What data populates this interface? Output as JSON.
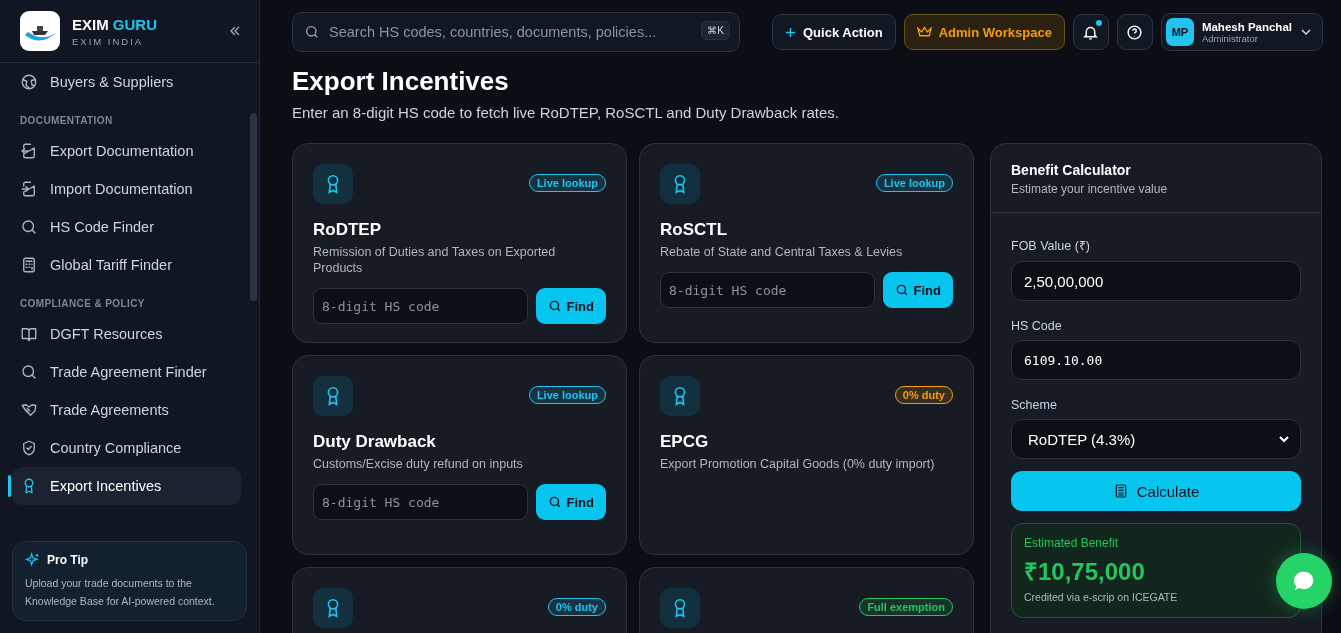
{
  "brand": {
    "name_1": "EXIM",
    "name_2": "GURU",
    "subtitle": "EXIM INDIA"
  },
  "sidebar": {
    "items": [
      {
        "kind": "item",
        "label": "Buyers & Suppliers",
        "selected": false
      },
      {
        "kind": "heading",
        "label": "DOCUMENTATION"
      },
      {
        "kind": "item",
        "label": "Export Documentation",
        "selected": false
      },
      {
        "kind": "item",
        "label": "Import Documentation",
        "selected": false
      },
      {
        "kind": "item",
        "label": "HS Code Finder",
        "selected": false
      },
      {
        "kind": "item",
        "label": "Global Tariff Finder",
        "selected": false
      },
      {
        "kind": "heading",
        "label": "COMPLIANCE & POLICY"
      },
      {
        "kind": "item",
        "label": "DGFT Resources",
        "selected": false
      },
      {
        "kind": "item",
        "label": "Trade Agreement Finder",
        "selected": false
      },
      {
        "kind": "item",
        "label": "Trade Agreements",
        "selected": false
      },
      {
        "kind": "item",
        "label": "Country Compliance",
        "selected": false
      },
      {
        "kind": "item",
        "label": "Export Incentives",
        "selected": true
      }
    ],
    "pro_tip": {
      "title": "Pro Tip",
      "text": "Upload your trade documents to the Knowledge Base for AI-powered context."
    }
  },
  "topbar": {
    "search_placeholder": "Search HS codes, countries, documents, policies...",
    "shortcut": "⌘K",
    "quick_action": "Quick Action",
    "admin": "Admin Workspace",
    "has_notification": true,
    "user": {
      "initials": "MP",
      "name": "Mahesh Panchal",
      "role": "Administrator"
    }
  },
  "page": {
    "title": "Export Incentives",
    "subtitle": "Enter an 8-digit HS code to fetch live RoDTEP, RoSCTL and Duty Drawback rates."
  },
  "cards": [
    {
      "kind": "lookup",
      "title": "RoDTEP",
      "description": "Remission of Duties and Taxes on Exported Products",
      "badge": "Live lookup",
      "color": "#22c3ee",
      "placeholder": "8-digit HS code",
      "button": "Find"
    },
    {
      "kind": "lookup",
      "title": "RoSCTL",
      "description": "Rebate of State and Central Taxes & Levies",
      "badge": "Live lookup",
      "color": "#22c3ee",
      "placeholder": "8-digit HS code",
      "button": "Find"
    },
    {
      "kind": "lookup",
      "title": "Duty Drawback",
      "description": "Customs/Excise duty refund on inputs",
      "badge": "Live lookup",
      "color": "#22c3ee",
      "placeholder": "8-digit HS code",
      "button": "Find"
    },
    {
      "kind": "info",
      "title": "EPCG",
      "description": "Export Promotion Capital Goods (0% duty import)",
      "badge": "0% duty",
      "color": "#f59e0b"
    },
    {
      "kind": "info",
      "badge": "0% duty",
      "color": "#22c3ee"
    },
    {
      "kind": "info",
      "badge": "Full exemption",
      "color": "#22c55e"
    }
  ],
  "calculator": {
    "title": "Benefit Calculator",
    "subtitle": "Estimate your incentive value",
    "fob_label": "FOB Value (₹)",
    "fob_value": "2,50,00,000",
    "hs_label": "HS Code",
    "hs_value": "6109.10.00",
    "scheme_label": "Scheme",
    "scheme_value": "RoDTEP (4.3%)",
    "button": "Calculate",
    "result": {
      "label": "Estimated Benefit",
      "value": "₹10,75,000",
      "note": "Credited via e-scrip on ICEGATE"
    }
  }
}
